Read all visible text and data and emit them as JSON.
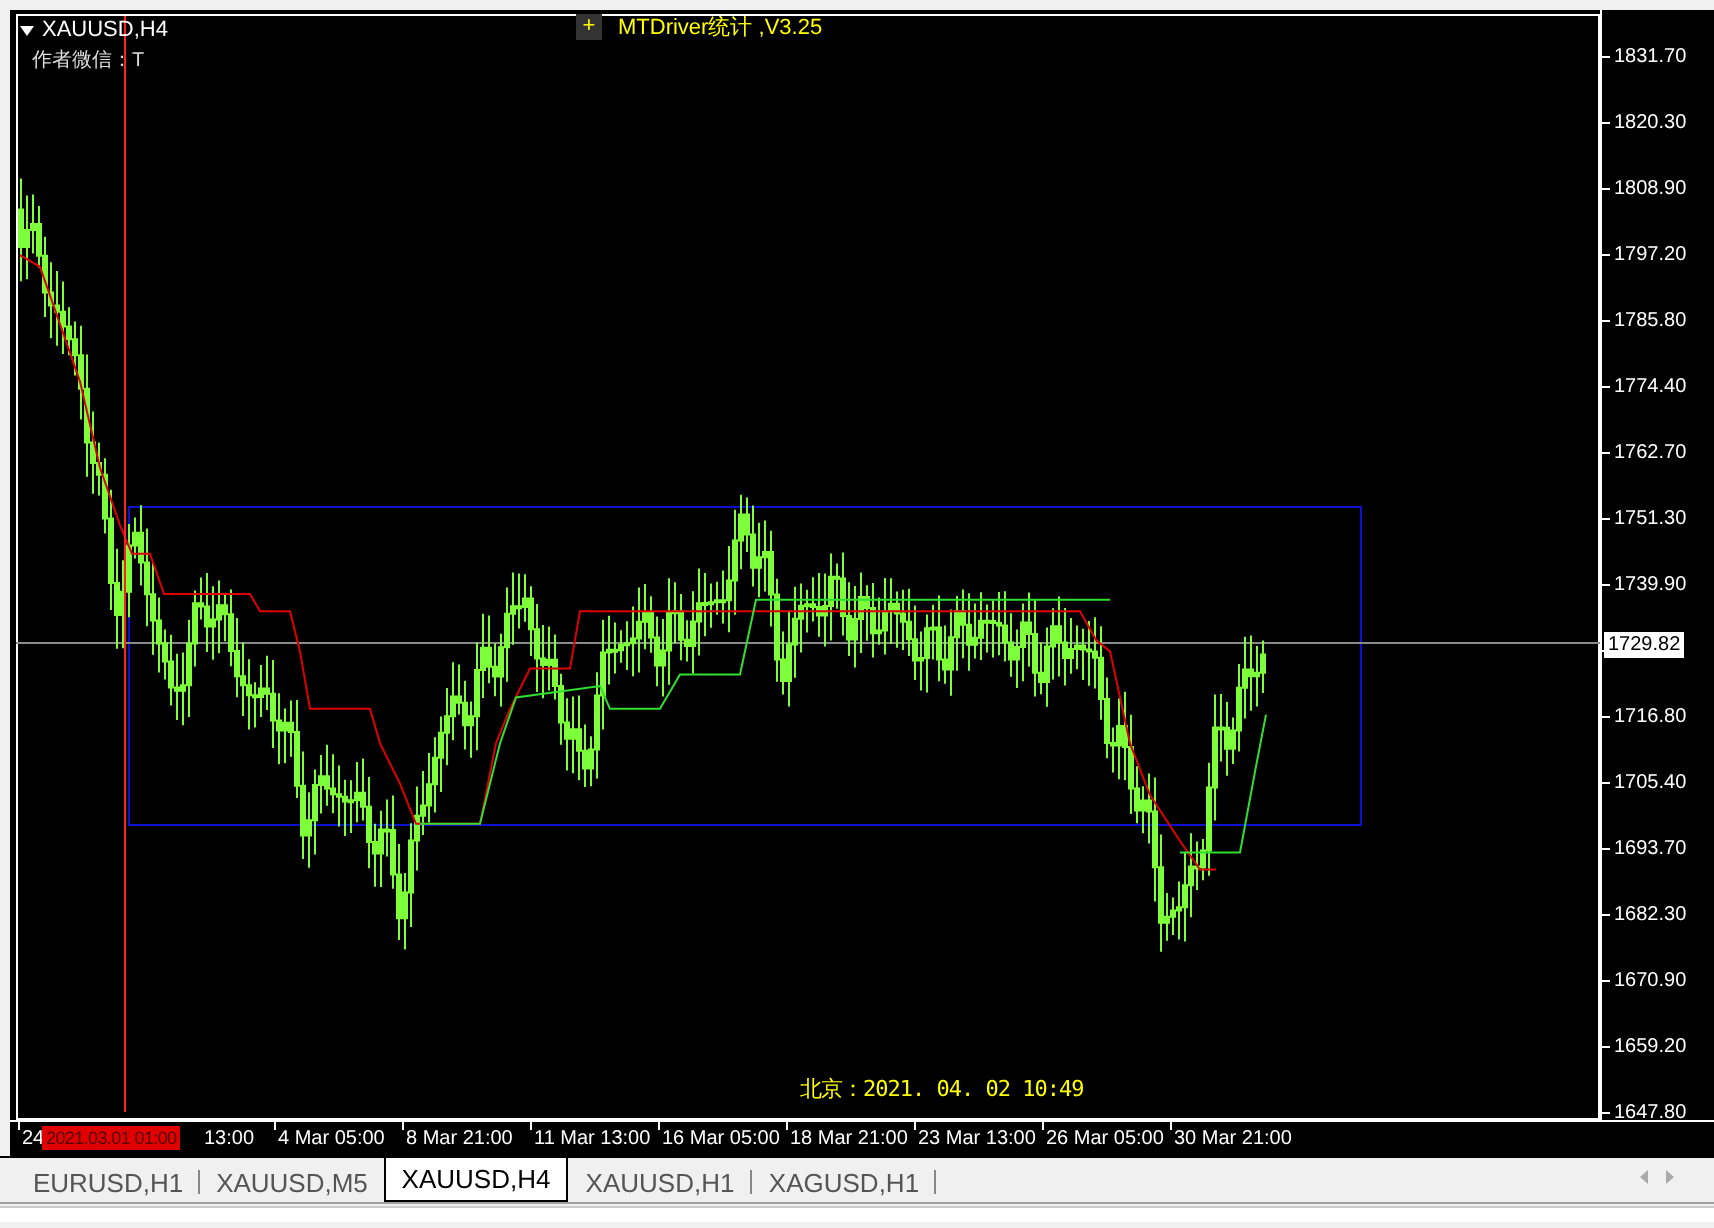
{
  "chart": {
    "title": "XAUUSD,H4",
    "author_label": "作者微信：T",
    "indicator_button": "+",
    "indicator_title": "MTDriver统计 ,V3.25",
    "clock": "北京：2021. 04. 02 10:49",
    "price_axis": [
      {
        "kind": "tick",
        "label": "1831.70"
      },
      {
        "kind": "tick",
        "label": "1820.30"
      },
      {
        "kind": "tick",
        "label": "1808.90"
      },
      {
        "kind": "tick",
        "label": "1797.20"
      },
      {
        "kind": "tick",
        "label": "1785.80"
      },
      {
        "kind": "tick",
        "label": "1774.40"
      },
      {
        "kind": "tick",
        "label": "1762.70"
      },
      {
        "kind": "tick",
        "label": "1751.30"
      },
      {
        "kind": "tick",
        "label": "1739.90"
      },
      {
        "kind": "current",
        "label": "1729.82"
      },
      {
        "kind": "tick",
        "label": "1716.80"
      },
      {
        "kind": "tick",
        "label": "1705.40"
      },
      {
        "kind": "tick",
        "label": "1693.70"
      },
      {
        "kind": "tick",
        "label": "1682.30"
      },
      {
        "kind": "tick",
        "label": "1670.90"
      },
      {
        "kind": "tick",
        "label": "1659.20"
      },
      {
        "kind": "tick",
        "label": "1647.80"
      }
    ],
    "time_axis": [
      "24",
      "13:00",
      "4 Mar 05:00",
      "8 Mar 21:00",
      "11 Mar 13:00",
      "16 Mar 05:00",
      "18 Mar 21:00",
      "23 Mar 13:00",
      "26 Mar 05:00",
      "30 Mar 21:00"
    ],
    "crosshair_time": "2021.03.01 01:00"
  },
  "tabs": [
    {
      "label": "EURUSD,H1",
      "selected": false
    },
    {
      "label": "XAUUSD,M5",
      "selected": false
    },
    {
      "label": "XAUUSD,H4",
      "selected": true
    },
    {
      "label": "XAUUSD,H1",
      "selected": false
    },
    {
      "label": "XAGUSD,H1",
      "selected": false
    }
  ]
}
